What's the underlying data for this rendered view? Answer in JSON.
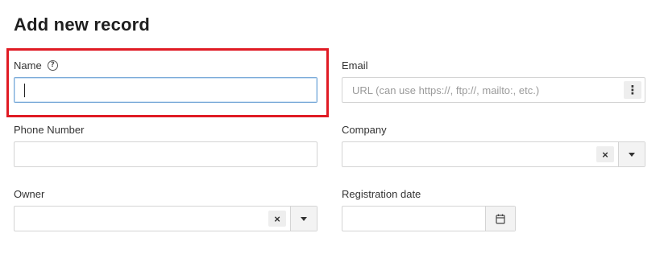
{
  "form": {
    "title": "Add new record",
    "fields": {
      "name": {
        "label": "Name",
        "value": "",
        "help_icon": "question-circle-icon"
      },
      "email": {
        "label": "Email",
        "value": "",
        "placeholder": "URL (can use https://, ftp://, mailto:, etc.)",
        "menu_glyph": "⋮"
      },
      "phone": {
        "label": "Phone Number",
        "value": ""
      },
      "company": {
        "label": "Company",
        "value": "",
        "clear_glyph": "×"
      },
      "owner": {
        "label": "Owner",
        "value": "",
        "clear_glyph": "×"
      },
      "registration_date": {
        "label": "Registration date",
        "value": "",
        "icon": "calendar-icon"
      }
    }
  },
  "colors": {
    "highlight": "#e01b24",
    "focus_border": "#78a9d8"
  }
}
